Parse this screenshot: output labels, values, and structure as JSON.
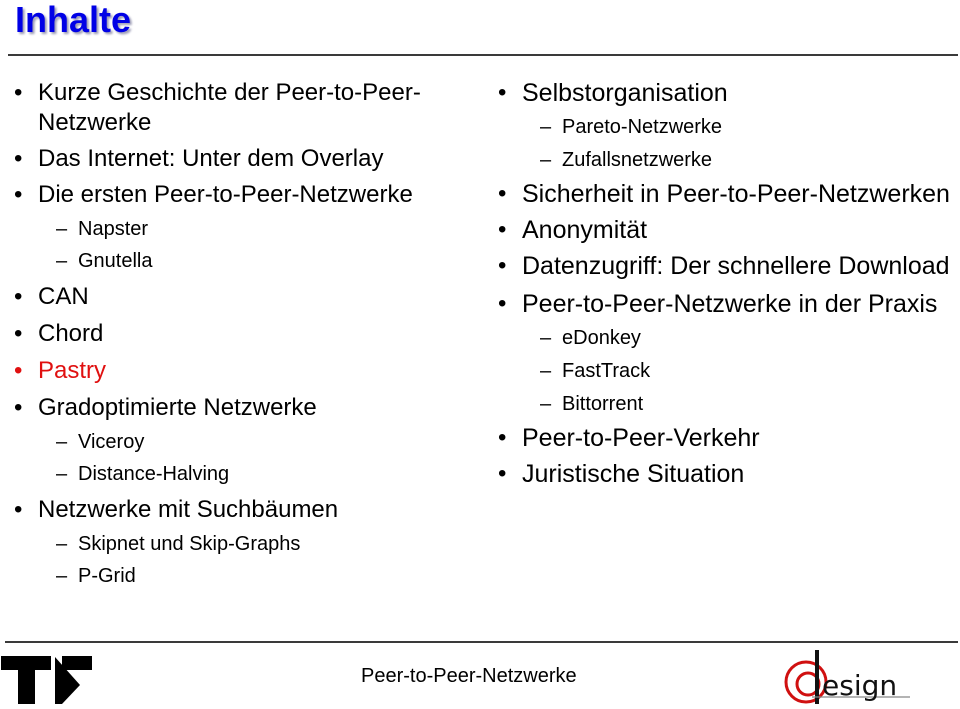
{
  "slide": {
    "title": "Inhalte",
    "accent_color": "#0000e6",
    "highlight_color": "#e01010"
  },
  "left_column": {
    "items": [
      {
        "level": 1,
        "text": "Kurze Geschichte der Peer-to-Peer-Netzwerke",
        "highlight": false
      },
      {
        "level": 1,
        "text": "Das Internet: Unter dem Overlay",
        "highlight": false
      },
      {
        "level": 1,
        "text": "Die ersten Peer-to-Peer-Netzwerke",
        "highlight": false
      },
      {
        "level": 2,
        "text": "Napster",
        "highlight": false
      },
      {
        "level": 2,
        "text": "Gnutella",
        "highlight": false
      },
      {
        "level": 1,
        "text": "CAN",
        "highlight": false
      },
      {
        "level": 1,
        "text": "Chord",
        "highlight": false
      },
      {
        "level": 1,
        "text": "Pastry",
        "highlight": true
      },
      {
        "level": 1,
        "text": "Gradoptimierte Netzwerke",
        "highlight": false
      },
      {
        "level": 2,
        "text": "Viceroy",
        "highlight": false
      },
      {
        "level": 2,
        "text": "Distance-Halving",
        "highlight": false
      },
      {
        "level": 1,
        "text": "Netzwerke mit Suchbäumen",
        "highlight": false
      },
      {
        "level": 2,
        "text": "Skipnet und Skip-Graphs",
        "highlight": false
      },
      {
        "level": 2,
        "text": "P-Grid",
        "highlight": false
      }
    ]
  },
  "right_column": {
    "items": [
      {
        "level": 1,
        "text": "Selbstorganisation"
      },
      {
        "level": 2,
        "text": "Pareto-Netzwerke"
      },
      {
        "level": 2,
        "text": "Zufallsnetzwerke"
      },
      {
        "level": 1,
        "text": "Sicherheit in Peer-to-Peer-Netzwerken"
      },
      {
        "level": 1,
        "text": "Anonymität"
      },
      {
        "level": 1,
        "text": "Datenzugriff: Der schnellere Download"
      },
      {
        "level": 1,
        "text": "Peer-to-Peer-Netzwerke in der Praxis"
      },
      {
        "level": 2,
        "text": "eDonkey"
      },
      {
        "level": 2,
        "text": "FastTrack"
      },
      {
        "level": 2,
        "text": "Bittorrent"
      },
      {
        "level": 1,
        "text": "Peer-to-Peer-Verkehr"
      },
      {
        "level": 1,
        "text": "Juristische Situation"
      }
    ]
  },
  "symbols": {
    "bullet": "•",
    "dash": "–"
  },
  "footer": {
    "text": "Peer-to-Peer-Netzwerke",
    "logo_left": "tu-logo-icon",
    "logo_right_text": "esign"
  }
}
